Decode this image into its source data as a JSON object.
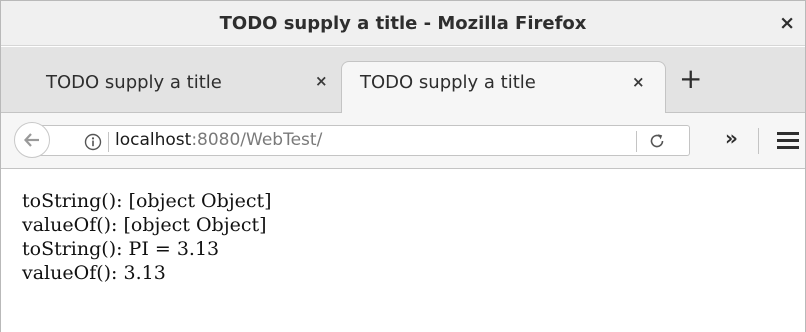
{
  "window": {
    "title": "TODO supply a title - Mozilla Firefox",
    "close_glyph": "×"
  },
  "tabs": [
    {
      "label": "TODO supply a title",
      "active": false,
      "close_glyph": "×"
    },
    {
      "label": "TODO supply a title",
      "active": true,
      "close_glyph": "×"
    }
  ],
  "new_tab_glyph": "+",
  "navbar": {
    "url_host": "localhost",
    "url_rest": ":8080/WebTest/",
    "overflow_glyph": "»",
    "icons": [
      "back-arrow-icon",
      "info-icon",
      "reload-icon",
      "hamburger-menu-icon"
    ]
  },
  "content": {
    "lines": [
      "toString(): [object Object]",
      "valueOf(): [object Object]",
      "toString(): PI = 3.13",
      "valueOf(): 3.13"
    ]
  }
}
